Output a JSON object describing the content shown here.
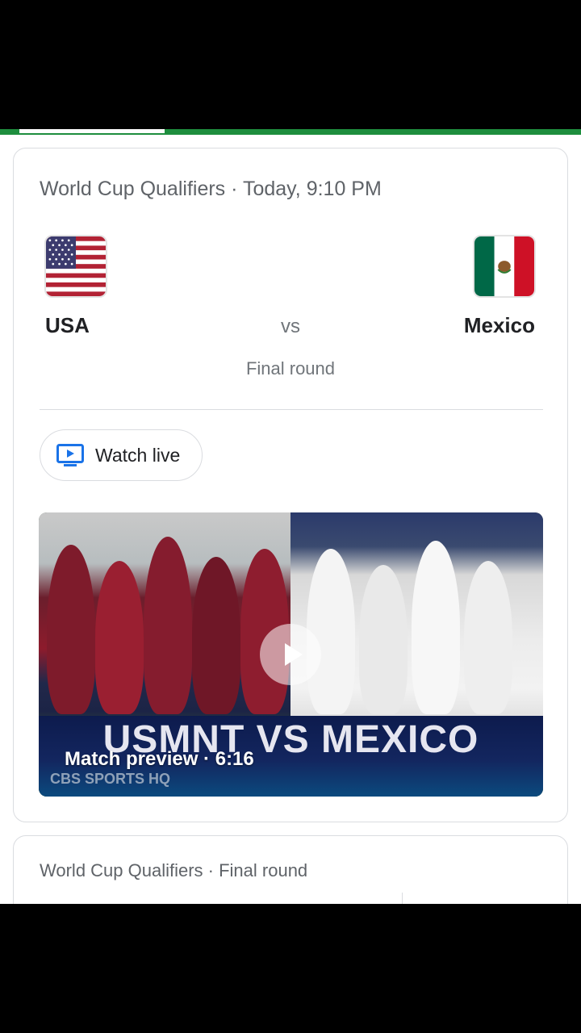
{
  "progress": {
    "fraction": 0.25
  },
  "match_card": {
    "subtitle": "World Cup Qualifiers · Today, 9:10 PM",
    "home_team": {
      "name": "USA",
      "flag_icon": "usa-flag-icon"
    },
    "away_team": {
      "name": "Mexico",
      "flag_icon": "mexico-flag-icon"
    },
    "vs_label": "vs",
    "round_label": "Final round",
    "watch_button": {
      "label": "Watch live",
      "icon": "tv-play-icon",
      "icon_color": "#1a73e8"
    },
    "video": {
      "banner_title": "USMNT VS MEXICO",
      "meta": "Match preview  ·  6:16",
      "brand": "CBS SPORTS HQ"
    }
  },
  "next_card": {
    "subtitle": "World Cup Qualifiers · Final round"
  },
  "colors": {
    "accent_green": "#1e8e3e",
    "text_primary": "#202124",
    "text_secondary": "#5f6368"
  }
}
